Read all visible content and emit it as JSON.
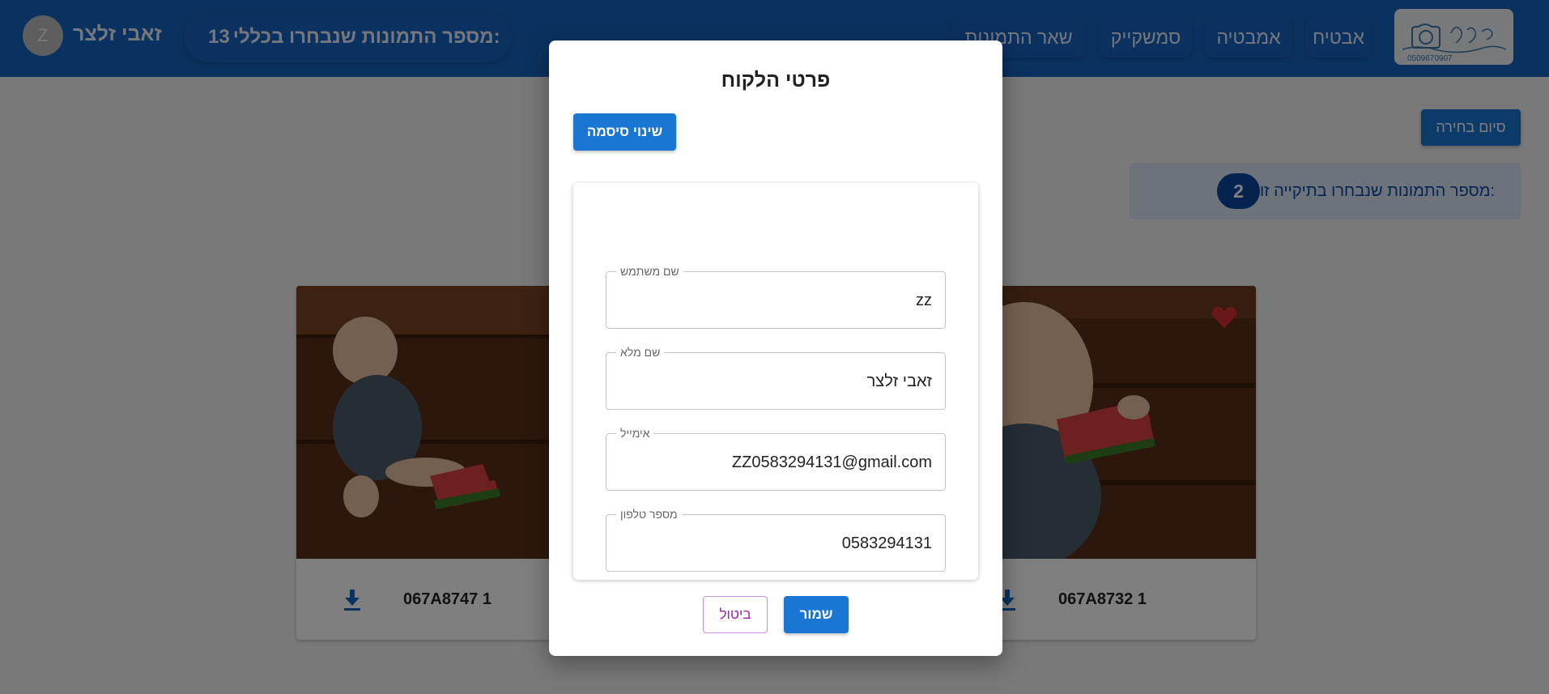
{
  "header": {
    "nav_items": [
      "אבטיח",
      "אמבטיה",
      "סמשקייק",
      "שאר התמונות"
    ],
    "total_selected_label": "מספר התמונות שנבחרו בכללי:",
    "total_selected_count": "13",
    "user_name": "זאבי זלצר",
    "avatar_initial": "Z",
    "logo_phone": "0509670907"
  },
  "main": {
    "finish_button": "סיום בחירה",
    "folder_selected_label": "מספר התמונות שנבחרו בתיקייה זו:",
    "folder_selected_count": "2",
    "photos": [
      {
        "id": "067A8732 1",
        "favorite": true
      },
      {
        "id": "067A8747 1",
        "favorite": false
      }
    ]
  },
  "modal": {
    "title": "פרטי הלקוח",
    "change_password_button": "שינוי סיסמה",
    "fields": [
      {
        "label": "שם משתמש",
        "value": "zz"
      },
      {
        "label": "שם מלא",
        "value": "זאבי זלצר"
      },
      {
        "label": "אימייל",
        "value": "ZZ0583294131@gmail.com"
      },
      {
        "label": "מספר טלפון",
        "value": "0583294131"
      }
    ],
    "save_button": "שמור",
    "cancel_button": "ביטול"
  },
  "colors": {
    "primary": "#1976d2",
    "header": "#1565c0",
    "favorite": "#d32f2f",
    "cancel": "#9c27b0"
  }
}
